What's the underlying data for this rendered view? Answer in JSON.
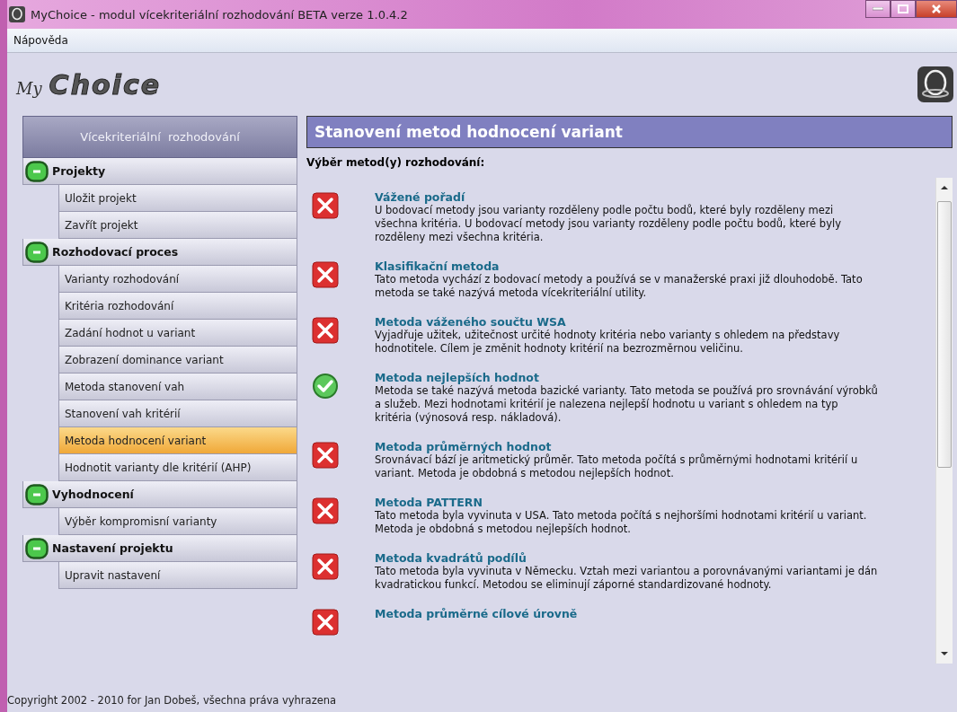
{
  "window": {
    "title": "MyChoice - modul vícekriteriální rozhodování BETA verze 1.0.4.2"
  },
  "menu": [
    "Nápověda"
  ],
  "logo": {
    "prefix": "My",
    "name": "Choice"
  },
  "sidebar": {
    "title": "Vícekriteriální  rozhodování",
    "groups": [
      {
        "label": "Projekty",
        "expanded": true,
        "children": [
          {
            "label": "Uložit projekt",
            "selected": false
          },
          {
            "label": "Zavřít projekt",
            "selected": false
          }
        ]
      },
      {
        "label": "Rozhodovací proces",
        "expanded": true,
        "children": [
          {
            "label": "Varianty rozhodování",
            "selected": false
          },
          {
            "label": "Kritéria rozhodování",
            "selected": false
          },
          {
            "label": "Zadání hodnot u variant",
            "selected": false
          },
          {
            "label": "Zobrazení dominance variant",
            "selected": false
          },
          {
            "label": "Metoda stanovení vah",
            "selected": false
          },
          {
            "label": "Stanovení vah kritérií",
            "selected": false
          },
          {
            "label": "Metoda hodnocení variant",
            "selected": true
          },
          {
            "label": "Hodnotit varianty dle kritérií (AHP)",
            "selected": false
          }
        ]
      },
      {
        "label": "Vyhodnocení",
        "expanded": true,
        "children": [
          {
            "label": "Výběr kompromisní varianty",
            "selected": false
          }
        ]
      },
      {
        "label": "Nastavení projektu",
        "expanded": true,
        "children": [
          {
            "label": "Upravit nastavení",
            "selected": false
          }
        ]
      }
    ]
  },
  "panel": {
    "title": "Stanovení metod hodnocení variant",
    "subtitle": "Výběr metod(y) rozhodování:",
    "methods": [
      {
        "title": "Vážené pořadí",
        "description": "U bodovací metody jsou varianty rozděleny podle počtu bodů, které byly rozděleny mezi všechna kritéria. U bodovací metody jsou varianty rozděleny podle počtu bodů, které byly rozděleny mezi všechna kritéria.",
        "selected": false
      },
      {
        "title": "Klasifikační metoda",
        "description": "Tato metoda vychází z bodovací metody a používá se v manažerské praxi již dlouhodobě. Tato metoda se také nazývá metoda vícekriteriální utility.",
        "selected": false
      },
      {
        "title": "Metoda váženého součtu WSA",
        "description": "Vyjadřuje užitek, užitečnost určité hodnoty kritéria nebo varianty s ohledem na představy hodnotitele. Cílem je změnit hodnoty kritérií na bezrozměrnou veličinu.",
        "selected": false
      },
      {
        "title": "Metoda nejlepších hodnot",
        "description": "Metoda se také nazývá metoda bazické varianty. Tato metoda se používá pro srovnávání výrobků a služeb. Mezi hodnotami kritérií je nalezena nejlepší hodnotu u variant s ohledem na typ kritéria (výnosová resp. nákladová).",
        "selected": true
      },
      {
        "title": "Metoda průměrných hodnot",
        "description": "Srovnávací bází je aritmetický průměr. Tato metoda počítá s průměrnými hodnotami kritérií u variant. Metoda je obdobná s metodou nejlepších hodnot.",
        "selected": false
      },
      {
        "title": "Metoda PATTERN",
        "description": "Tato metoda byla vyvinuta v USA. Tato metoda počítá s nejhoršími hodnotami kritérií u variant. Metoda je obdobná s metodou nejlepších hodnot.",
        "selected": false
      },
      {
        "title": "Metoda kvadrátů podílů",
        "description": "Tato metoda byla vyvinuta v Německu. Vztah mezi variantou a porovnávanými variantami je dán kvadratickou funkcí. Metodou se eliminují záporné standardizované hodnoty.",
        "selected": false
      },
      {
        "title": "Metoda průměrné cílové úrovně",
        "selected": false
      }
    ]
  },
  "status_bar": "Copyright 2002 - 2010 for Jan Dobeš, všechna práva vyhrazena"
}
